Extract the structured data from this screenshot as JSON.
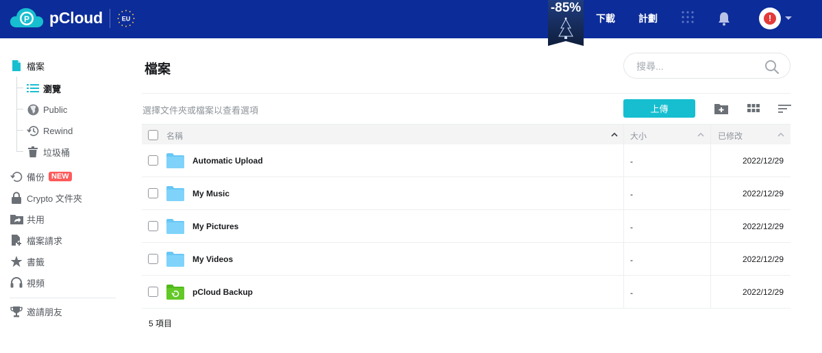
{
  "header": {
    "brand": "pCloud",
    "eu_badge": "EU",
    "promo": "-85%",
    "nav": {
      "download": "下載",
      "plans": "計劃"
    },
    "avatar_alert": "!",
    "colors": {
      "bar": "#0c2c99",
      "accent": "#17bed0"
    }
  },
  "sidebar": {
    "files": {
      "label": "檔案",
      "icon": "file-icon"
    },
    "sub": [
      {
        "label": "瀏覽",
        "icon": "list-icon",
        "active": true
      },
      {
        "label": "Public",
        "icon": "globe-icon"
      },
      {
        "label": "Rewind",
        "icon": "history-icon"
      },
      {
        "label": "垃圾桶",
        "icon": "trash-icon"
      }
    ],
    "items": [
      {
        "label": "備份",
        "icon": "backup-icon",
        "badge": "NEW"
      },
      {
        "label": "Crypto 文件夾",
        "icon": "lock-icon"
      },
      {
        "label": "共用",
        "icon": "share-folder-icon"
      },
      {
        "label": "檔案請求",
        "icon": "file-request-icon"
      },
      {
        "label": "書籤",
        "icon": "star-icon"
      },
      {
        "label": "視頻",
        "icon": "headphones-icon"
      }
    ],
    "invite": {
      "label": "邀請朋友",
      "icon": "trophy-icon"
    }
  },
  "main": {
    "title": "檔案",
    "search_placeholder": "搜尋...",
    "hint": "選擇文件夾或檔案以查看選項",
    "upload": "上傳",
    "columns": {
      "name": "名稱",
      "size": "大小",
      "modified": "已修改"
    },
    "rows": [
      {
        "name": "Automatic Upload",
        "size": "-",
        "modified": "2022/12/29",
        "type": "folder"
      },
      {
        "name": "My Music",
        "size": "-",
        "modified": "2022/12/29",
        "type": "folder"
      },
      {
        "name": "My Pictures",
        "size": "-",
        "modified": "2022/12/29",
        "type": "folder"
      },
      {
        "name": "My Videos",
        "size": "-",
        "modified": "2022/12/29",
        "type": "folder"
      },
      {
        "name": "pCloud Backup",
        "size": "-",
        "modified": "2022/12/29",
        "type": "backup-folder"
      }
    ],
    "count": "5 項目"
  }
}
